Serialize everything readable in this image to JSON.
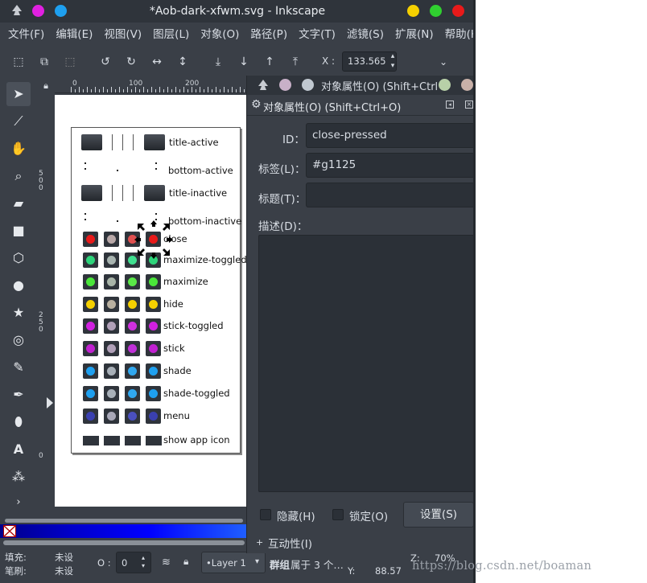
{
  "window": {
    "title": "*Aob-dark-xfwm.svg - Inkscape",
    "colors": {
      "pink": "#e020e0",
      "cyan": "#1ea0f0",
      "yellow": "#f5d000",
      "green": "#30d030",
      "red": "#e81a1a"
    }
  },
  "menu": [
    "文件(F)",
    "编辑(E)",
    "视图(V)",
    "图层(L)",
    "对象(O)",
    "路径(P)",
    "文字(T)",
    "滤镜(S)",
    "扩展(N)",
    "帮助(H)"
  ],
  "toolbar": {
    "x_label": "X :",
    "x_value": "133.565",
    "icons": [
      "select-all-icon",
      "select-all-layers-icon",
      "deselect-icon",
      "rotate-ccw-icon",
      "rotate-cw-icon",
      "flip-horizontal-icon",
      "flip-vertical-icon",
      "lower-bottom-icon",
      "lower-icon",
      "raise-icon",
      "raise-top-icon"
    ]
  },
  "rulers": {
    "h": [
      "0",
      "100",
      "200"
    ],
    "v": [
      "5\n0\n0",
      "2\n5\n0",
      "0"
    ]
  },
  "drawing": {
    "rows": [
      {
        "label": "title-active",
        "kind": "bars"
      },
      {
        "label": "bottom-active",
        "kind": "dots"
      },
      {
        "label": "title-inactive",
        "kind": "bars"
      },
      {
        "label": "bottom-inactive",
        "kind": "dots"
      },
      {
        "label": "close",
        "kind": "buttons",
        "colors": [
          "#e81a1a",
          "#b8a8a8",
          "#e05050",
          "#e81a1a"
        ]
      },
      {
        "label": "maximize-toggled",
        "kind": "buttons",
        "colors": [
          "#2dd47a",
          "#a8b4b0",
          "#40e090",
          "#2dd47a"
        ]
      },
      {
        "label": "maximize",
        "kind": "buttons",
        "colors": [
          "#4ae63a",
          "#a8b4a8",
          "#5ae848",
          "#4ae63a"
        ]
      },
      {
        "label": "hide",
        "kind": "buttons",
        "colors": [
          "#f5d000",
          "#b8b0a0",
          "#f5d000",
          "#f5d000"
        ]
      },
      {
        "label": "stick-toggled",
        "kind": "buttons",
        "colors": [
          "#d020e0",
          "#b0a0b8",
          "#d030e0",
          "#d020e0"
        ]
      },
      {
        "label": "stick",
        "kind": "buttons",
        "colors": [
          "#c020d0",
          "#b0a0b8",
          "#c030d8",
          "#c020d0"
        ]
      },
      {
        "label": "shade",
        "kind": "buttons",
        "colors": [
          "#1ea0f0",
          "#a8b0b8",
          "#30a8f0",
          "#1ea0f0"
        ]
      },
      {
        "label": "shade-toggled",
        "kind": "buttons",
        "colors": [
          "#1ea0f0",
          "#a8b0b8",
          "#30a8f0",
          "#1ea0f0"
        ]
      },
      {
        "label": "menu",
        "kind": "buttons",
        "colors": [
          "#3a40b0",
          "#a8a8b8",
          "#4a50c0",
          "#3a40b0"
        ]
      },
      {
        "label": "show app icon",
        "kind": "boxes"
      }
    ]
  },
  "dialog": {
    "tab_title": "对象属性(O) (Shift+Ctrl",
    "title": "对象属性(O) (Shift+Ctrl+O)",
    "id_label": "ID：",
    "id_value": "close-pressed",
    "label_label": "标签(L)：",
    "label_value": "#g1125",
    "title_label": "标题(T)：",
    "title_value": "",
    "desc_label": "描述(D)：",
    "hide_label": "隐藏(H)",
    "lock_label": "锁定(O)",
    "set_button": "设置(S)",
    "interactivity_label": "互动性(I)",
    "tab_colors": [
      "#c8b0c8",
      "#c0c8d0",
      "#b8d0a8",
      "#c8b0a8"
    ]
  },
  "status": {
    "fill_label": "填充:",
    "fill_value": "未设",
    "stroke_label": "笔刷:",
    "stroke_value": "未设",
    "opacity_label": "O :",
    "opacity_value": "0",
    "layer": "•Layer 1",
    "message_bold": "群组",
    "message": " 属于 3 个…",
    "y_label": "Y:",
    "y_value": "88.57",
    "zoom_label": "Z:",
    "zoom_value": "70%"
  },
  "watermark": "https://blog.csdn.net/boaman"
}
